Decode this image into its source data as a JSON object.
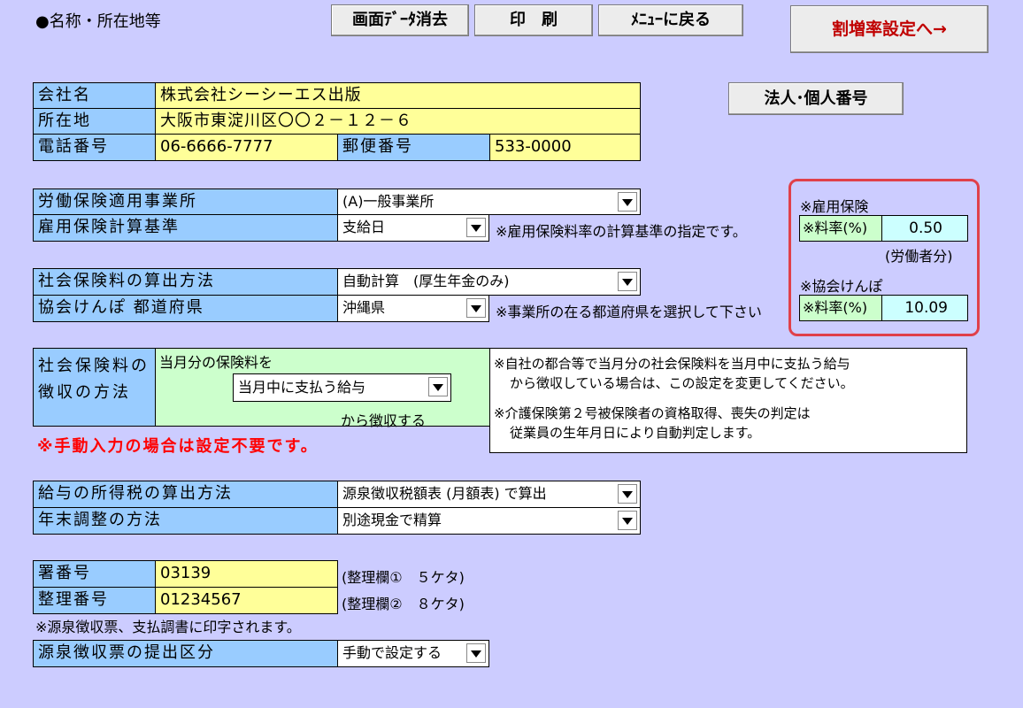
{
  "header": {
    "section_title": "●名称・所在地等"
  },
  "toolbar": {
    "clear_label": "画面ﾃﾞｰﾀ消去",
    "print_label": "印　刷",
    "menu_label": "ﾒﾆｭｰに戻る",
    "rate_settings_label": "割増率設定へ→",
    "my_number_label": "法人･個人番号",
    "rate_settings_color": "#C00000"
  },
  "company": {
    "name_label": "会社名",
    "name_value": "株式会社シーシーエス出版",
    "address_label": "所在地",
    "address_value": "大阪市東淀川区〇〇２－１２－６",
    "phone_label": "電話番号",
    "phone_value": "06-6666-7777",
    "postal_label": "郵便番号",
    "postal_value": "533-0000"
  },
  "labor": {
    "office_label": "労働保険適用事業所",
    "office_value": "(A)一般事業所",
    "calc_basis_label": "雇用保険計算基準",
    "calc_basis_value": "支給日",
    "calc_basis_note": "※雇用保険料率の計算基準の指定です。"
  },
  "social": {
    "method_label": "社会保険料の算出方法",
    "method_value": "自動計算　(厚生年金のみ)",
    "pref_label": "協会けんぽ 都道府県",
    "pref_value": "沖縄県",
    "pref_note": "※事業所の在る都道府県を選択して下さい"
  },
  "rates": {
    "employment_title": "※雇用保険",
    "employment_rate_label": "※料率(%)",
    "employment_rate_value": "0.50",
    "employment_sub": "(労働者分)",
    "kyokai_title": "※協会けんぽ",
    "kyokai_rate_label": "※料率(%)",
    "kyokai_rate_value": "10.09",
    "highlight_color": "#E0404A"
  },
  "collection": {
    "label_line1": "社会保険料の",
    "label_line2": "徴収の方法",
    "prefix": "当月分の保険料を",
    "select_value": "当月中に支払う給与",
    "suffix": "から徴収する",
    "warning": "※手動入力の場合は設定不要です。",
    "note1_line1": "※自社の都合等で当月分の社会保険料を当月中に支払う給与",
    "note1_line2": "から徴収している場合は、この設定を変更してください。",
    "note2_line1": "※介護保険第２号被保険者の資格取得、喪失の判定は",
    "note2_line2": "従業員の生年月日により自動判定します。"
  },
  "tax": {
    "income_tax_label": "給与の所得税の算出方法",
    "income_tax_value": "源泉徴収税額表 (月額表) で算出",
    "year_end_label": "年末調整の方法",
    "year_end_value": "別途現金で精算"
  },
  "office_numbers": {
    "tax_office_label": "署番号",
    "tax_office_value": "03139",
    "tax_office_note": "(整理欄①　５ケタ)",
    "ref_label": "整理番号",
    "ref_value": "01234567",
    "ref_note": "(整理欄②　８ケタ)",
    "print_note": "※源泉徴収票、支払調書に印字されます。",
    "submit_label": "源泉徴収票の提出区分",
    "submit_value": "手動で設定する"
  }
}
